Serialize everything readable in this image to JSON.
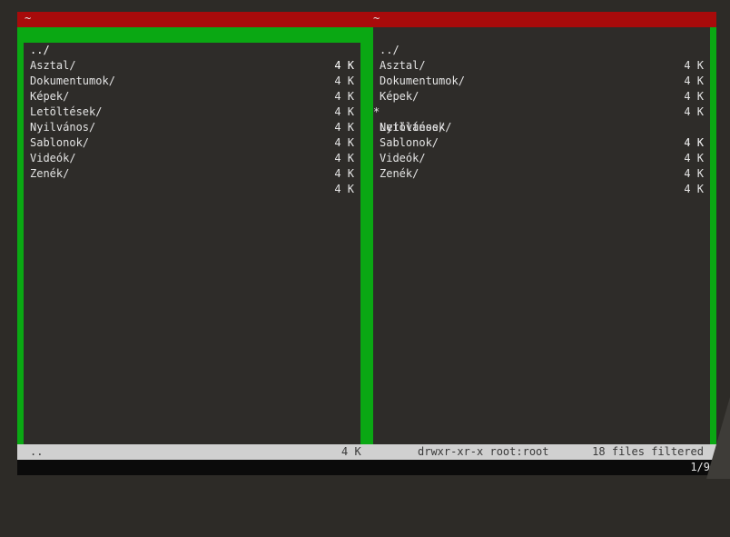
{
  "titlebar": {
    "left": "~",
    "center": "~"
  },
  "left_panel": {
    "entries": [
      {
        "name": "../",
        "size": "4 K",
        "selected": true
      },
      {
        "name": "Asztal/",
        "size": "4 K"
      },
      {
        "name": "Dokumentumok/",
        "size": "4 K"
      },
      {
        "name": "Képek/",
        "size": "4 K"
      },
      {
        "name": "Letöltések/",
        "size": "4 K"
      },
      {
        "name": "Nyilvános/",
        "size": "4 K"
      },
      {
        "name": "Sablonok/",
        "size": "4 K"
      },
      {
        "name": "Videók/",
        "size": "4 K"
      },
      {
        "name": "Zenék/",
        "size": "4 K"
      }
    ]
  },
  "right_panel": {
    "entries": [
      {
        "name": "../",
        "size": "4 K"
      },
      {
        "name": "Asztal/",
        "size": "4 K"
      },
      {
        "name": "Dokumentumok/",
        "size": "4 K"
      },
      {
        "name": "Képek/",
        "size": "4 K"
      },
      {
        "name": "Letöltések/",
        "size": "4 K",
        "mark": "*"
      },
      {
        "name": "Nyilvános/",
        "size": "4 K"
      },
      {
        "name": "Sablonok/",
        "size": "4 K"
      },
      {
        "name": "Videók/",
        "size": "4 K"
      },
      {
        "name": "Zenék/",
        "size": "4 K"
      }
    ]
  },
  "statusbar": {
    "name": "..",
    "size": "4 K",
    "permissions": "drwxr-xr-x root:root",
    "filter": "18 files filtered"
  },
  "cmdline": {
    "position": "1/9"
  },
  "colors": {
    "accent": "#0aa813",
    "title": "#a80b0b"
  }
}
